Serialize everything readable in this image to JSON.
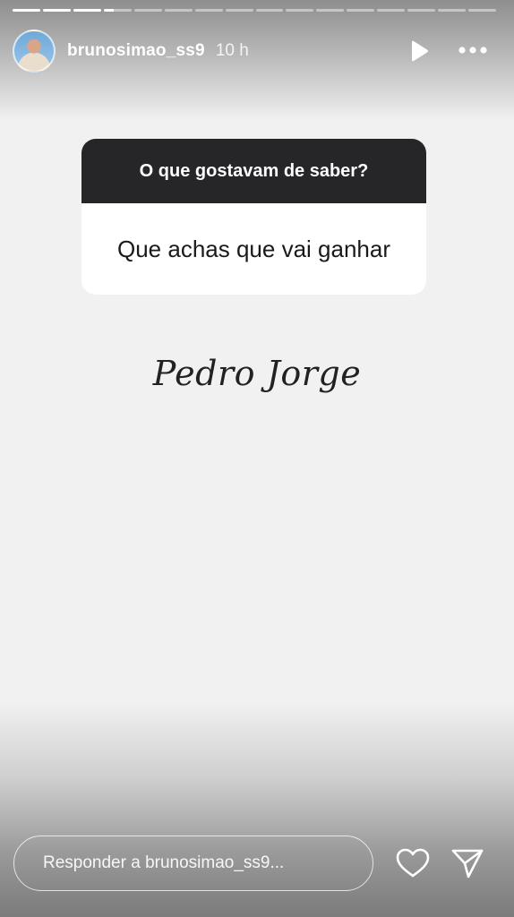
{
  "header": {
    "username": "brunosimao_ss9",
    "time": "10 h",
    "play_icon": "play-icon",
    "more_icon": "more-icon"
  },
  "progress": {
    "segments_total": 16,
    "segments_done": 4
  },
  "question_box": {
    "title": "O que gostavam de saber?",
    "question": "Que achas que vai ganhar"
  },
  "answer": {
    "text": "Pedro Jorge"
  },
  "footer": {
    "reply_placeholder": "Responder a brunosimao_ss9...",
    "like_icon": "heart-icon",
    "send_icon": "send-icon"
  }
}
